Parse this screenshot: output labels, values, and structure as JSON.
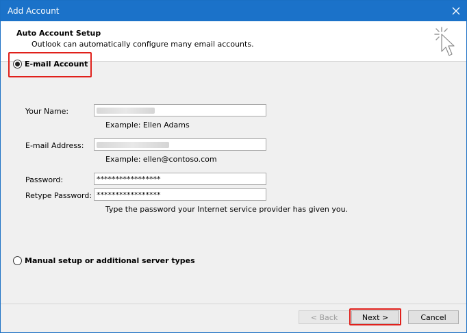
{
  "window": {
    "title": "Add Account"
  },
  "header": {
    "title": "Auto Account Setup",
    "subtitle": "Outlook can automatically configure many email accounts."
  },
  "options": {
    "email_account_label": "E-mail Account",
    "manual_setup_label": "Manual setup or additional server types",
    "selected": "email_account"
  },
  "form": {
    "name_label": "Your Name:",
    "name_example": "Example: Ellen Adams",
    "email_label": "E-mail Address:",
    "email_example": "Example: ellen@contoso.com",
    "password_label": "Password:",
    "password_value": "*****************",
    "retype_label": "Retype Password:",
    "retype_value": "*****************",
    "password_hint": "Type the password your Internet service provider has given you."
  },
  "buttons": {
    "back": "< Back",
    "next": "Next >",
    "cancel": "Cancel"
  },
  "colors": {
    "titlebar": "#1b72c9",
    "highlight": "#e0201b"
  },
  "icons": [
    "close-icon",
    "cursor-click-icon"
  ]
}
